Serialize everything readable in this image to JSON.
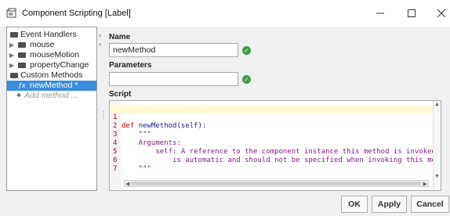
{
  "window": {
    "title": "Component Scripting [Label]"
  },
  "tree": {
    "event_handlers": "Event Handlers",
    "items": [
      "mouse",
      "mouseMotion",
      "propertyChange"
    ],
    "custom_methods": "Custom Methods",
    "selected_method": "newMethod *",
    "add_method": "Add method ..."
  },
  "form": {
    "name_label": "Name",
    "name_value": "newMethod",
    "parameters_label": "Parameters",
    "parameters_value": "",
    "script_label": "Script"
  },
  "script": {
    "lines": [
      {
        "n": "1",
        "code": "def newMethod(self):"
      },
      {
        "n": "2",
        "code": "    \"\"\""
      },
      {
        "n": "3",
        "code": "    Arguments:"
      },
      {
        "n": "4",
        "code": "        self: A reference to the component instance this method is invoked on."
      },
      {
        "n": "5",
        "code": "            is automatic and should not be specified when invoking this method."
      },
      {
        "n": "6",
        "code": "    \"\"\""
      },
      {
        "n": "7",
        "code": ""
      }
    ]
  },
  "buttons": {
    "ok": "OK",
    "apply": "Apply",
    "cancel": "Cancel"
  },
  "colors": {
    "selection": "#3a8edb",
    "valid": "#3d9a48",
    "keyword": "#c00000",
    "docstring": "#8a1a8a"
  },
  "icons": [
    "script-window-icon",
    "folder-icon",
    "checkmark-icon",
    "method-icon",
    "plus-icon"
  ]
}
